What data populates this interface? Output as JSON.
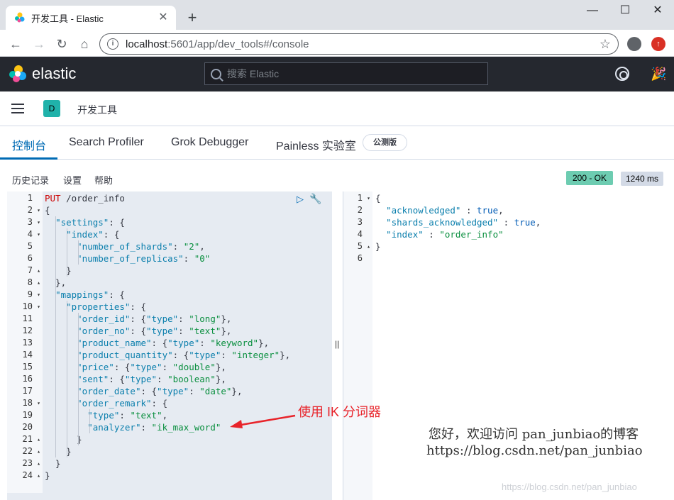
{
  "browser": {
    "tab_title": "开发工具 - Elastic",
    "url_host": "localhost",
    "url_rest": ":5601/app/dev_tools#/console",
    "window_controls": [
      "minimize-icon",
      "maximize-icon",
      "close-icon"
    ]
  },
  "kibana": {
    "brand": "elastic",
    "search_placeholder": "搜索 Elastic",
    "space_initial": "D",
    "breadcrumb": "开发工具"
  },
  "tabs": [
    {
      "label": "控制台",
      "active": true
    },
    {
      "label": "Search Profiler",
      "active": false
    },
    {
      "label": "Grok Debugger",
      "active": false
    },
    {
      "label": "Painless 实验室",
      "active": false
    }
  ],
  "beta_badge": "公测版",
  "toolbar": {
    "history": "历史记录",
    "settings": "设置",
    "help": "帮助",
    "status": "200 - OK",
    "duration": "1240 ms"
  },
  "request_lines": [
    "PUT /order_info",
    "{",
    "  \"settings\": {",
    "    \"index\": {",
    "      \"number_of_shards\": \"2\",",
    "      \"number_of_replicas\": \"0\"",
    "    }",
    "  },",
    "  \"mappings\": {",
    "    \"properties\": {",
    "      \"order_id\": {\"type\": \"long\"},",
    "      \"order_no\": {\"type\": \"text\"},",
    "      \"product_name\": {\"type\": \"keyword\"},",
    "      \"product_quantity\": {\"type\": \"integer\"},",
    "      \"price\": {\"type\": \"double\"},",
    "      \"sent\": {\"type\": \"boolean\"},",
    "      \"order_date\": {\"type\": \"date\"},",
    "      \"order_remark\": {",
    "        \"type\": \"text\",",
    "        \"analyzer\": \"ik_max_word\"",
    "      }",
    "    }",
    "  }",
    "}"
  ],
  "response_lines": [
    "{",
    "  \"acknowledged\" : true,",
    "  \"shards_acknowledged\" : true,",
    "  \"index\" : \"order_info\"",
    "}",
    ""
  ],
  "annotation": "使用 IK 分词器",
  "watermark": {
    "line1": "您好，欢迎访问 pan_junbiao的博客",
    "line2": "https://blog.csdn.net/pan_junbiao",
    "line3": "https://blog.csdn.net/pan_junbiao"
  },
  "colors": {
    "kibana_header": "#25282f",
    "accent_blue": "#006bb4",
    "status_ok": "#6dccb1",
    "annotation_red": "#e8232a"
  }
}
